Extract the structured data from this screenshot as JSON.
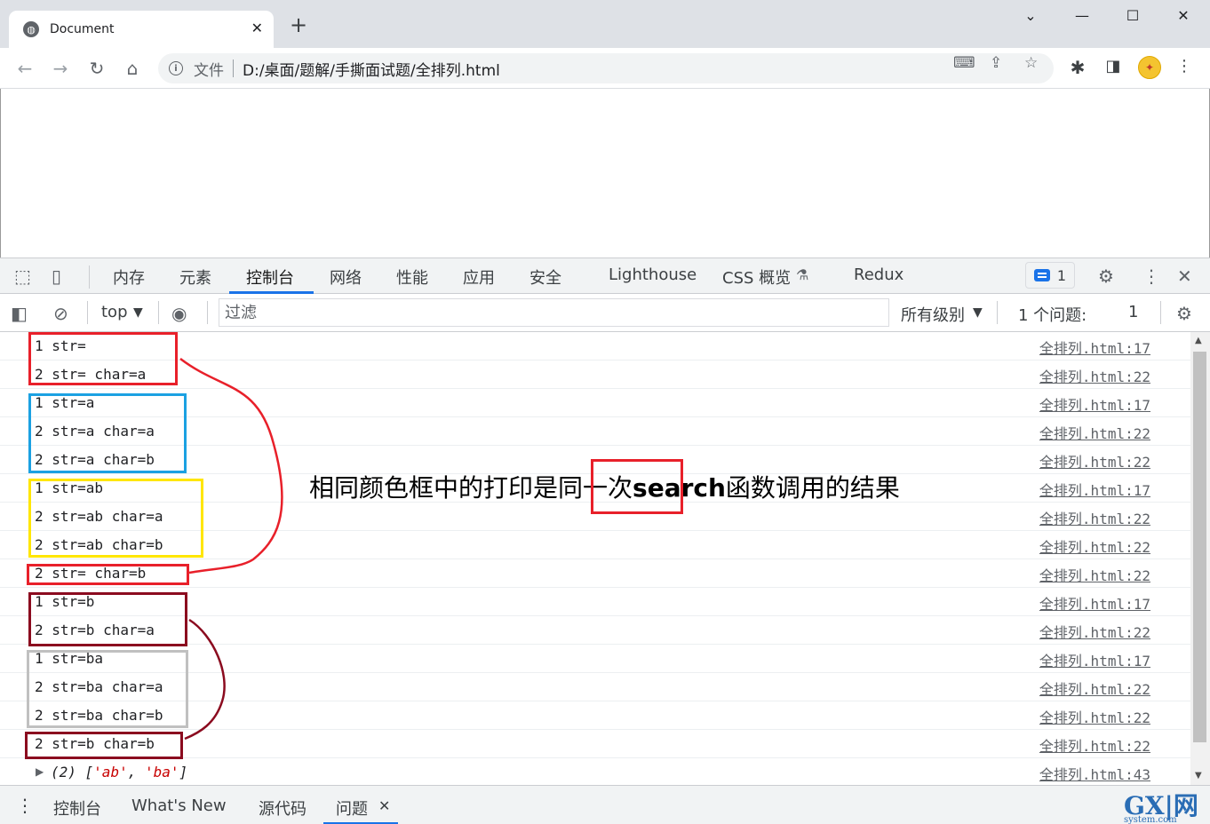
{
  "browser": {
    "tab_title": "Document",
    "protocol_label": "文件",
    "url": "D:/桌面/题解/手撕面试题/全排列.html"
  },
  "devtools": {
    "tabs": [
      "内存",
      "元素",
      "控制台",
      "网络",
      "性能",
      "应用",
      "安全",
      "Lighthouse",
      "CSS 概览",
      "Redux"
    ],
    "issues_count": "1",
    "console": {
      "context": "top",
      "filter_placeholder": "过滤",
      "level": "所有级别",
      "issues_label": "1 个问题:",
      "issues_count": "1"
    },
    "rows": [
      {
        "msg": "1 str=",
        "src": "全排列.html:17"
      },
      {
        "msg": "2 str= char=a",
        "src": "全排列.html:22"
      },
      {
        "msg": "1 str=a",
        "src": "全排列.html:17"
      },
      {
        "msg": "2 str=a char=a",
        "src": "全排列.html:22"
      },
      {
        "msg": "2 str=a char=b",
        "src": "全排列.html:22"
      },
      {
        "msg": "1 str=ab",
        "src": "全排列.html:17"
      },
      {
        "msg": "2 str=ab char=a",
        "src": "全排列.html:22"
      },
      {
        "msg": "2 str=ab char=b",
        "src": "全排列.html:22"
      },
      {
        "msg": "2 str= char=b",
        "src": "全排列.html:22"
      },
      {
        "msg": "1 str=b",
        "src": "全排列.html:17"
      },
      {
        "msg": "2 str=b char=a",
        "src": "全排列.html:22"
      },
      {
        "msg": "1 str=ba",
        "src": "全排列.html:17"
      },
      {
        "msg": "2 str=ba char=a",
        "src": "全排列.html:22"
      },
      {
        "msg": "2 str=ba char=b",
        "src": "全排列.html:22"
      },
      {
        "msg": "2 str=b char=b",
        "src": "全排列.html:22"
      }
    ],
    "result_row": {
      "prefix": "(2) [",
      "item1": "'ab'",
      "comma": ", ",
      "item2": "'ba'",
      "suffix": "]",
      "src": "全排列.html:43"
    },
    "drawer_tabs": [
      "控制台",
      "What's New",
      "源代码",
      "问题"
    ]
  },
  "annotation": {
    "before": "相同颜色框中的打印是",
    "highlight": "同一次",
    "bold": "search",
    "after": "函数调用的结果"
  },
  "box_colors": {
    "red": "#e8202a",
    "blue": "#1ba1e2",
    "yellow": "#ffe600",
    "maroon": "#8b0b1f",
    "gray": "#c0c0c0"
  },
  "watermark": {
    "main": "GX|网",
    "sub": "system.com"
  }
}
